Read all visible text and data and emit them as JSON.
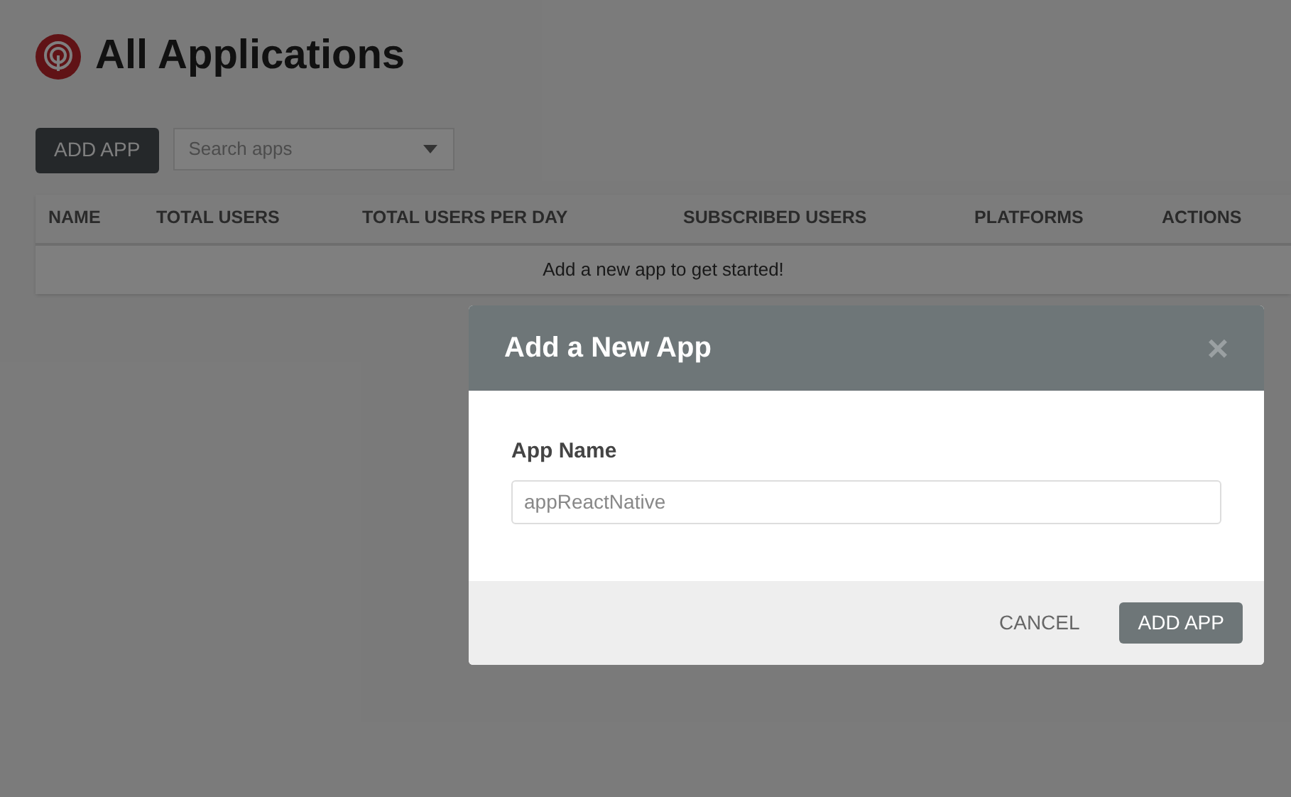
{
  "page": {
    "title": "All Applications",
    "add_button": "ADD APP",
    "search": {
      "placeholder": "Search apps"
    }
  },
  "table": {
    "columns": [
      "NAME",
      "TOTAL USERS",
      "TOTAL USERS PER DAY",
      "SUBSCRIBED USERS",
      "PLATFORMS",
      "ACTIONS"
    ],
    "empty_message": "Add a new app to get started!"
  },
  "dialog": {
    "title": "Add a New App",
    "close": "×",
    "field_label": "App Name",
    "field_value": "appReactNative",
    "buttons": [
      {
        "label": "CANCEL",
        "kind": "secondary"
      },
      {
        "label": "ADD APP",
        "kind": "primary"
      }
    ]
  }
}
